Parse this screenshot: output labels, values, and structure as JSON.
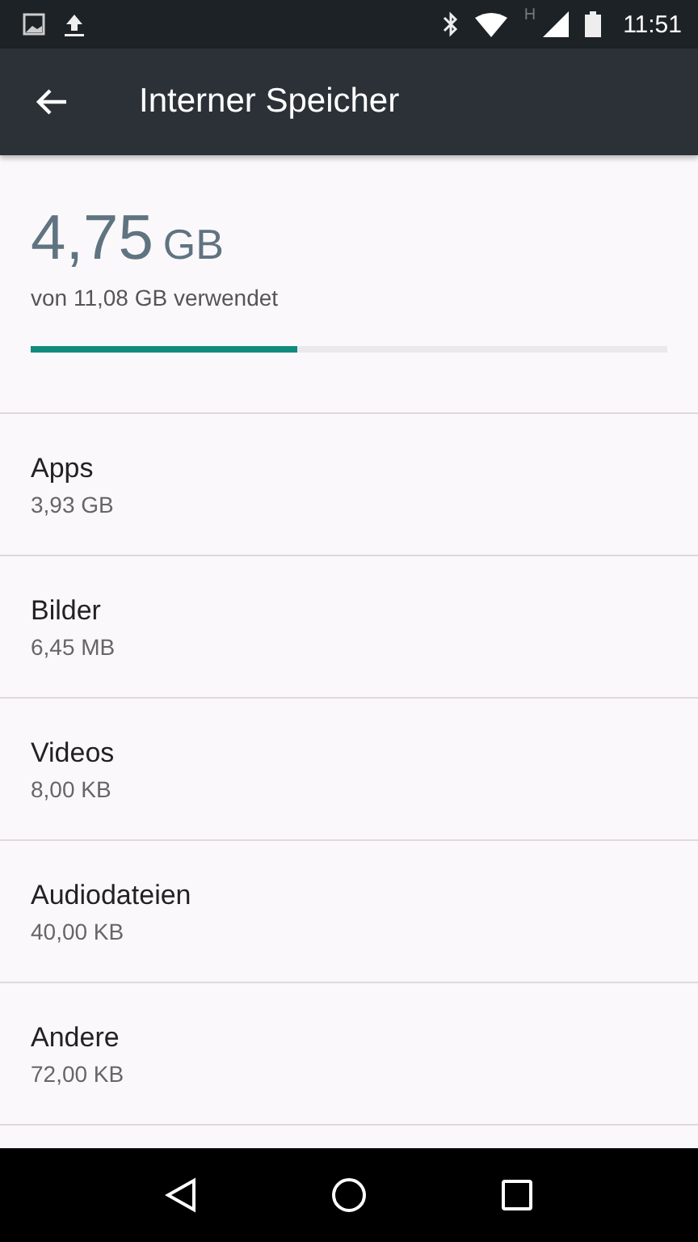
{
  "status_bar": {
    "network_type": "H",
    "time": "11:51"
  },
  "app_bar": {
    "title": "Interner Speicher"
  },
  "summary": {
    "amount": "4,75",
    "unit": "GB",
    "caption": "von 11,08 GB verwendet",
    "level": 0.42
  },
  "items": [
    {
      "label": "Apps",
      "size": "3,93 GB"
    },
    {
      "label": "Bilder",
      "size": "6,45 MB"
    },
    {
      "label": "Videos",
      "size": "8,00 KB"
    },
    {
      "label": "Audiodateien",
      "size": "40,00 KB"
    },
    {
      "label": "Andere",
      "size": "72,00 KB"
    }
  ]
}
